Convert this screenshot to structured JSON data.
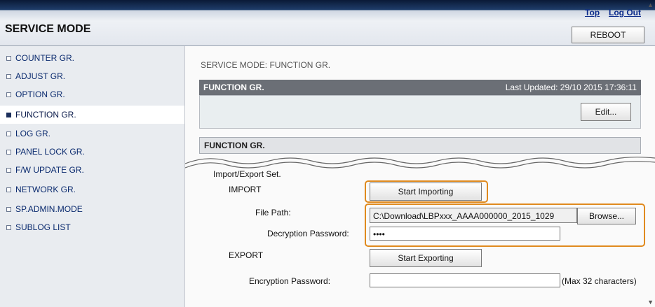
{
  "header": {
    "title": "SERVICE MODE",
    "top_link": "Top",
    "logout_link": "Log Out",
    "reboot_label": "REBOOT"
  },
  "sidebar": {
    "items": [
      {
        "label": "COUNTER GR."
      },
      {
        "label": "ADJUST GR."
      },
      {
        "label": "OPTION GR."
      },
      {
        "label": "FUNCTION GR.",
        "active": true
      },
      {
        "label": "LOG GR."
      },
      {
        "label": "PANEL LOCK GR."
      },
      {
        "label": "F/W UPDATE GR."
      },
      {
        "label": "NETWORK GR."
      },
      {
        "label": "SP.ADMIN.MODE"
      },
      {
        "label": "SUBLOG LIST"
      }
    ]
  },
  "main": {
    "breadcrumb": "SERVICE MODE: FUNCTION GR.",
    "panel_title": "FUNCTION GR.",
    "last_updated": "Last Updated: 29/10 2015 17:36:11",
    "edit_label": "Edit...",
    "panel2_title": "FUNCTION GR.",
    "import_export_label": "Import/Export Set.",
    "import_label": "IMPORT",
    "start_importing_label": "Start Importing",
    "file_path_label": "File Path:",
    "file_path_value": "C:\\Download\\LBPxxx_AAAA000000_2015_1029",
    "browse_label": "Browse...",
    "decryption_label": "Decryption Password:",
    "decryption_value": "••••",
    "export_label": "EXPORT",
    "start_exporting_label": "Start Exporting",
    "encryption_label": "Encryption Password:",
    "encryption_value": "",
    "max_chars_note": "(Max 32 characters)"
  },
  "colors": {
    "highlight": "#e08a1e",
    "panel_header": "#6b6f76",
    "sidebar_bg": "#e9ecf0"
  }
}
